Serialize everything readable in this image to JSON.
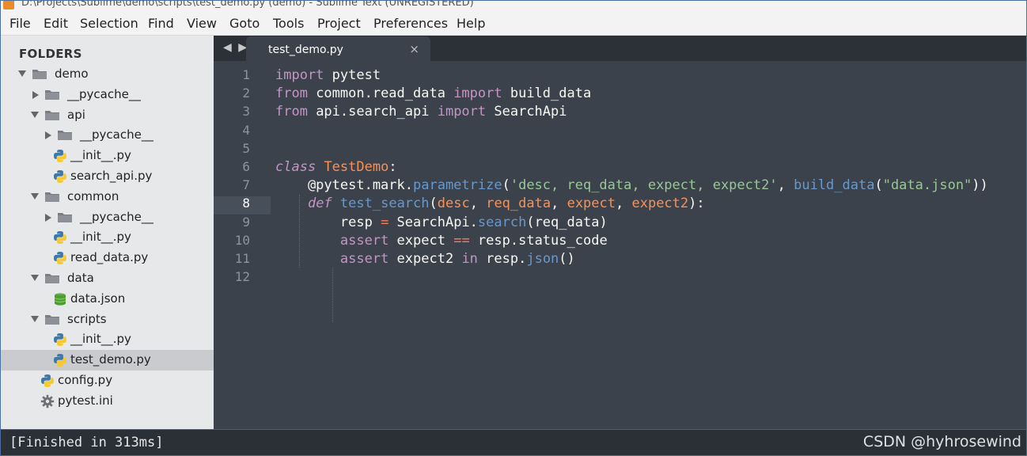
{
  "window": {
    "title": "D:\\Projects\\Sublime\\demo\\scripts\\test_demo.py (demo) - Sublime Text (UNREGISTERED)"
  },
  "menu": [
    "File",
    "Edit",
    "Selection",
    "Find",
    "View",
    "Goto",
    "Tools",
    "Project",
    "Preferences",
    "Help"
  ],
  "sidebar": {
    "heading": "FOLDERS",
    "items": [
      {
        "label": "demo",
        "type": "folder",
        "expanded": true
      },
      {
        "label": "__pycache__",
        "type": "folder",
        "expanded": false
      },
      {
        "label": "api",
        "type": "folder",
        "expanded": true
      },
      {
        "label": "__pycache__",
        "type": "folder",
        "expanded": false
      },
      {
        "label": "__init__.py",
        "type": "python-file"
      },
      {
        "label": "search_api.py",
        "type": "python-file"
      },
      {
        "label": "common",
        "type": "folder",
        "expanded": true
      },
      {
        "label": "__pycache__",
        "type": "folder",
        "expanded": false
      },
      {
        "label": "__init__.py",
        "type": "python-file"
      },
      {
        "label": "read_data.py",
        "type": "python-file"
      },
      {
        "label": "data",
        "type": "folder",
        "expanded": true
      },
      {
        "label": "data.json",
        "type": "json-file"
      },
      {
        "label": "scripts",
        "type": "folder",
        "expanded": true
      },
      {
        "label": "__init__.py",
        "type": "python-file"
      },
      {
        "label": "test_demo.py",
        "type": "python-file",
        "selected": true
      },
      {
        "label": "config.py",
        "type": "python-file"
      },
      {
        "label": "pytest.ini",
        "type": "settings-file"
      }
    ]
  },
  "editor": {
    "tab_label": "test_demo.py",
    "tab_close": "×",
    "tab_nav": "◀ ▶",
    "current_line": 8,
    "line_numbers": [
      "1",
      "2",
      "3",
      "4",
      "5",
      "6",
      "7",
      "8",
      "9",
      "10",
      "11",
      "12"
    ],
    "code": [
      [
        {
          "t": "import",
          "c": "kw"
        },
        {
          "t": " pytest",
          "c": "ws"
        }
      ],
      [
        {
          "t": "from",
          "c": "kw"
        },
        {
          "t": " common.read_data ",
          "c": "ws"
        },
        {
          "t": "import",
          "c": "kw"
        },
        {
          "t": " build_data",
          "c": "ws"
        }
      ],
      [
        {
          "t": "from",
          "c": "kw"
        },
        {
          "t": " api.search_api ",
          "c": "ws"
        },
        {
          "t": "import",
          "c": "kw"
        },
        {
          "t": " SearchApi",
          "c": "ws"
        }
      ],
      [],
      [],
      [
        {
          "t": "class",
          "c": "kw-i"
        },
        {
          "t": " ",
          "c": "ws"
        },
        {
          "t": "TestDemo",
          "c": "cls"
        },
        {
          "t": ":",
          "c": "ws"
        }
      ],
      [
        {
          "t": "    @pytest.mark.",
          "c": "dec"
        },
        {
          "t": "parametrize",
          "c": "fn"
        },
        {
          "t": "(",
          "c": "ws"
        },
        {
          "t": "'desc, req_data, expect, expect2'",
          "c": "str"
        },
        {
          "t": ", ",
          "c": "ws"
        },
        {
          "t": "build_data",
          "c": "fn"
        },
        {
          "t": "(",
          "c": "ws"
        },
        {
          "t": "\"data.json\"",
          "c": "str"
        },
        {
          "t": "))",
          "c": "ws"
        }
      ],
      [
        {
          "t": "    ",
          "c": "ws"
        },
        {
          "t": "def",
          "c": "kw-i"
        },
        {
          "t": " ",
          "c": "ws"
        },
        {
          "t": "test_search",
          "c": "fn"
        },
        {
          "t": "(",
          "c": "ws"
        },
        {
          "t": "desc",
          "c": "par"
        },
        {
          "t": ", ",
          "c": "ws"
        },
        {
          "t": "req_data",
          "c": "par"
        },
        {
          "t": ", ",
          "c": "ws"
        },
        {
          "t": "expect",
          "c": "par"
        },
        {
          "t": ", ",
          "c": "ws"
        },
        {
          "t": "expect2",
          "c": "par"
        },
        {
          "t": "):",
          "c": "ws"
        }
      ],
      [
        {
          "t": "        resp ",
          "c": "ws"
        },
        {
          "t": "=",
          "c": "op"
        },
        {
          "t": " SearchApi.",
          "c": "ws"
        },
        {
          "t": "search",
          "c": "fn"
        },
        {
          "t": "(req_data)",
          "c": "ws"
        }
      ],
      [
        {
          "t": "        ",
          "c": "ws"
        },
        {
          "t": "assert",
          "c": "kw"
        },
        {
          "t": " expect ",
          "c": "ws"
        },
        {
          "t": "==",
          "c": "op"
        },
        {
          "t": " resp.status_code",
          "c": "ws"
        }
      ],
      [
        {
          "t": "        ",
          "c": "ws"
        },
        {
          "t": "assert",
          "c": "kw"
        },
        {
          "t": " expect2 ",
          "c": "ws"
        },
        {
          "t": "in",
          "c": "kw"
        },
        {
          "t": " resp.",
          "c": "ws"
        },
        {
          "t": "json",
          "c": "fn"
        },
        {
          "t": "()",
          "c": "ws"
        }
      ],
      []
    ]
  },
  "console": {
    "output": "[Finished in 313ms]"
  },
  "watermark": "CSDN @hyhrosewind",
  "colors": {
    "editor_bg": "#3b424c",
    "sidebar_bg": "#e7e8ea",
    "keyword": "#c594c5",
    "function": "#6699cc",
    "string": "#99c794",
    "param": "#f99157"
  }
}
